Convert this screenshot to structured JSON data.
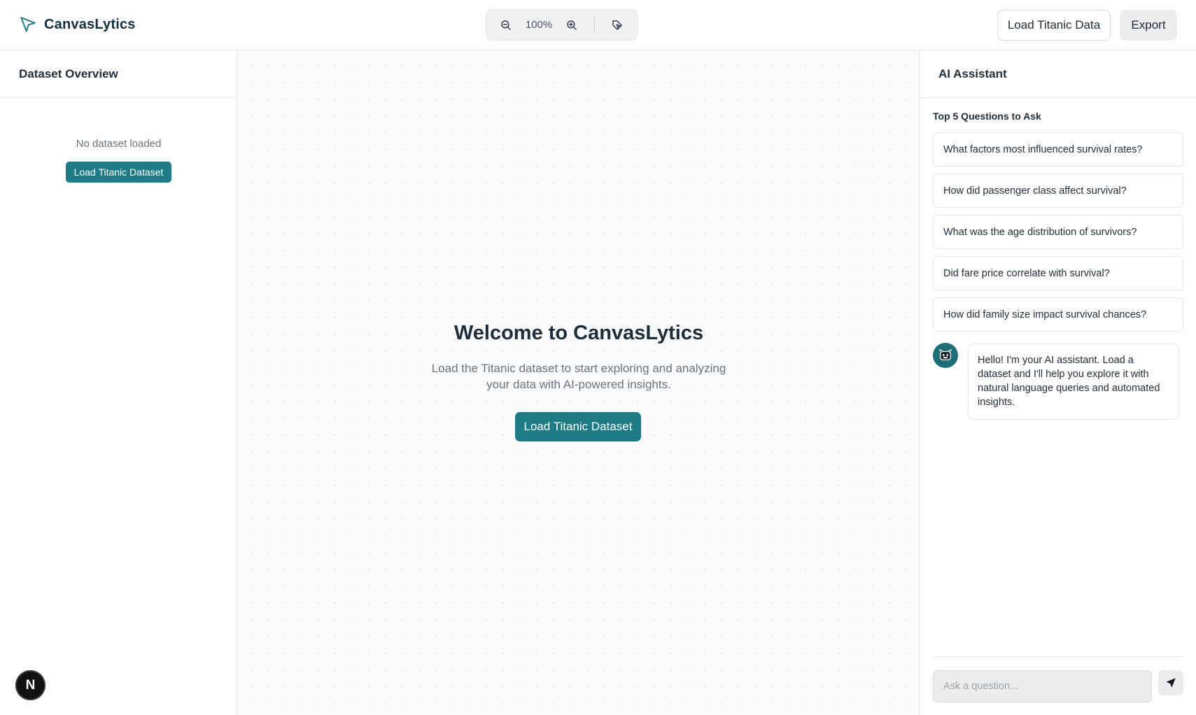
{
  "header": {
    "brand_name": "CanvasLytics",
    "zoom_level": "100%",
    "load_button": "Load Titanic Data",
    "export_button": "Export"
  },
  "left_panel": {
    "title": "Dataset Overview",
    "empty_text": "No dataset loaded",
    "load_button": "Load Titanic Dataset",
    "badge_letter": "N"
  },
  "canvas": {
    "title": "Welcome to CanvasLytics",
    "subtitle": "Load the Titanic dataset to start exploring and analyzing your data with AI-powered insights.",
    "load_button": "Load Titanic Dataset"
  },
  "assistant": {
    "title": "AI Assistant",
    "questions_heading": "Top 5 Questions to Ask",
    "questions": [
      "What factors most influenced survival rates?",
      "How did passenger class affect survival?",
      "What was the age distribution of survivors?",
      "Did fare price correlate with survival?",
      "How did family size impact survival chances?"
    ],
    "bot_message": "Hello! I'm your AI assistant. Load a dataset and I'll help you explore it with natural language queries and automated insights.",
    "input_placeholder": "Ask a question..."
  },
  "icons": {
    "brand": "send-arrow-icon",
    "zoom_out": "zoom-out-icon",
    "zoom_in": "zoom-in-icon",
    "select": "pointer-tag-icon",
    "bot": "bot-icon",
    "send": "send-icon"
  },
  "colors": {
    "accent": "#1e7b85",
    "border": "#e5e7eb",
    "text": "#1f2d3a"
  }
}
